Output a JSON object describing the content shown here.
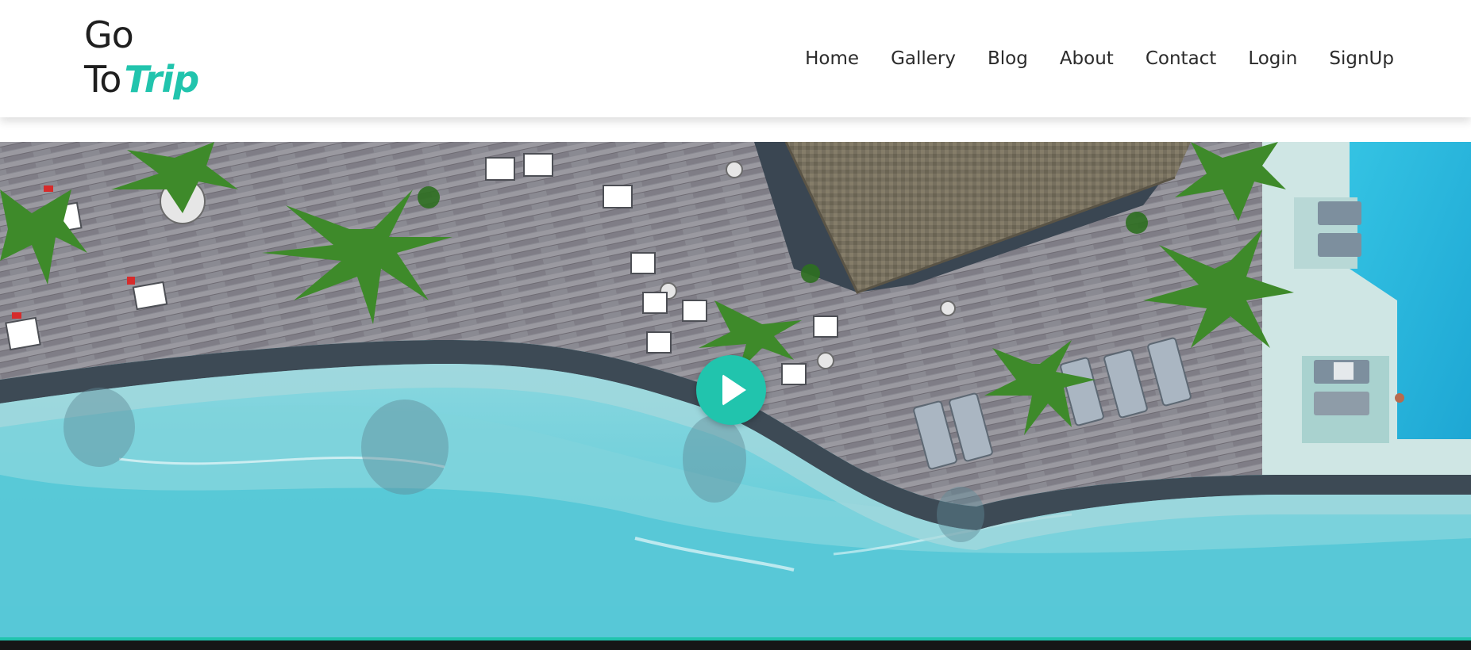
{
  "brand": {
    "line1": "Go",
    "line2_prefix": "To",
    "line2_accent": "Trip",
    "accent_color": "#21c4ad"
  },
  "nav": {
    "items": [
      {
        "label": "Home"
      },
      {
        "label": "Gallery"
      },
      {
        "label": "Blog"
      },
      {
        "label": "About"
      },
      {
        "label": "Contact"
      },
      {
        "label": "Login"
      },
      {
        "label": "SignUp"
      }
    ]
  },
  "hero": {
    "media": "aerial resort video",
    "play_icon": "play-icon"
  }
}
